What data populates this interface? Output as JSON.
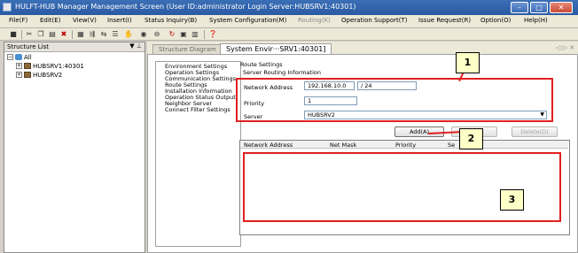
{
  "window": {
    "title": "HULFT-HUB Manager Management Screen (User ID:administrator Login Server:HUBSRV1:40301)",
    "minimize": "–",
    "maximize": "□",
    "close": "✕"
  },
  "menu": [
    "File(F)",
    "Edit(E)",
    "View(V)",
    "Insert(I)",
    "Status Inquiry(B)",
    "System Configuration(M)",
    "Routing(K)",
    "Operation Support(T)",
    "Issue Request(R)",
    "Option(O)",
    "Help(H)"
  ],
  "structure": {
    "title": "Structure List",
    "pin": "▼ ⊥",
    "root": "All",
    "servers": [
      "HUBSRV1:40301",
      "HUBSRV2"
    ]
  },
  "tabs": {
    "inactive": "Structure Diagram",
    "active": "System Envir···SRV1:40301]",
    "arrows": "◁ ▷ ✕"
  },
  "settings_list": [
    "Environment Settings",
    "Operation Settings",
    "Communication Settings",
    "Route Settings",
    "Installation Information",
    "Operation Status Output",
    "Neighbor Server",
    "Connect Filter Settings"
  ],
  "detail": {
    "heading": "Route Settings",
    "subheading": "Server Routing Information",
    "network_address_label": "Network Address",
    "network_address_value": "192.168.10.0",
    "mask_value": "/ 24",
    "priority_label": "Priority",
    "priority_value": "1",
    "server_label": "Server",
    "server_value": "HUBSRV2"
  },
  "buttons": {
    "add": "Add(A)",
    "update": "(U)",
    "delete": "Delete(D)"
  },
  "grid_columns": [
    "Network Address",
    "Net Mask",
    "Priority",
    "Se"
  ],
  "callouts": [
    "1",
    "2",
    "3"
  ],
  "colors": {
    "highlight": "#e02020",
    "callout_bg": "#ffffc8"
  }
}
